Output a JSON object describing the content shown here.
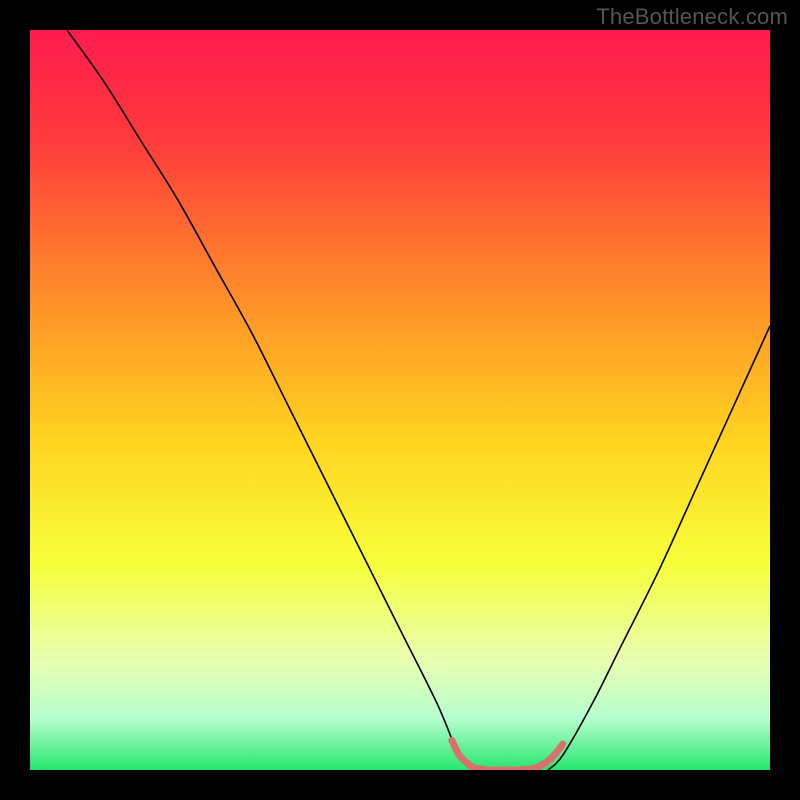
{
  "watermark": "TheBottleneck.com",
  "colors": {
    "frame": "#000000",
    "watermark_text": "#555555",
    "curve_stroke": "#000000",
    "highlight_stroke": "#d9706d"
  },
  "chart_data": {
    "type": "line",
    "title": "",
    "xlabel": "",
    "ylabel": "",
    "xlim": [
      0,
      100
    ],
    "ylim": [
      0,
      100
    ],
    "gradient_stops": [
      {
        "pos": 0.0,
        "color": "#ff1b4f"
      },
      {
        "pos": 0.15,
        "color": "#ff3b3b"
      },
      {
        "pos": 0.35,
        "color": "#ff8a2a"
      },
      {
        "pos": 0.55,
        "color": "#ffd21f"
      },
      {
        "pos": 0.72,
        "color": "#f7ff3a"
      },
      {
        "pos": 0.85,
        "color": "#e9ffb0"
      },
      {
        "pos": 0.93,
        "color": "#b6ffcf"
      },
      {
        "pos": 1.0,
        "color": "#27e66e"
      }
    ],
    "series": [
      {
        "name": "left-branch",
        "x": [
          5,
          10,
          15,
          20,
          25,
          30,
          35,
          40,
          45,
          50,
          55,
          58,
          60
        ],
        "y": [
          100,
          93,
          85,
          77,
          68,
          59,
          49,
          39,
          29,
          19,
          9,
          2,
          0
        ]
      },
      {
        "name": "right-branch",
        "x": [
          70,
          72,
          76,
          80,
          85,
          90,
          95,
          100
        ],
        "y": [
          0,
          2,
          9,
          17,
          27,
          38,
          49,
          60
        ]
      },
      {
        "name": "bottom-highlight",
        "x": [
          57,
          58,
          59,
          60,
          62,
          64,
          66,
          68,
          69,
          70,
          71,
          72
        ],
        "y": [
          4,
          2,
          1,
          0.3,
          0,
          0,
          0,
          0.2,
          0.6,
          1.2,
          2.2,
          3.5
        ]
      }
    ]
  }
}
